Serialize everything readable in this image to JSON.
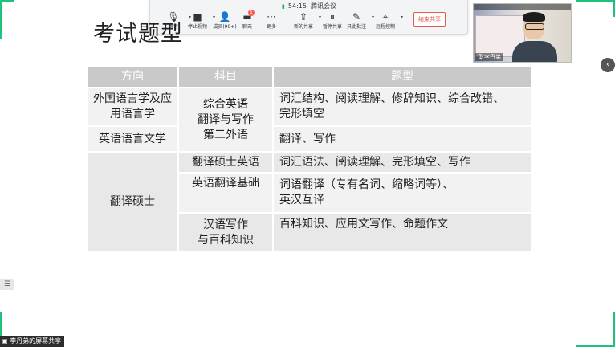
{
  "toolbar": {
    "time": "54:15",
    "app_name": "腾讯会议",
    "buttons": [
      {
        "label": "静音",
        "icon": "microphone-icon"
      },
      {
        "label": "停止视频",
        "icon": "camera-icon"
      },
      {
        "label": "成员(99+)",
        "icon": "members-icon"
      },
      {
        "label": "聊天",
        "icon": "chat-icon",
        "badge": "1"
      },
      {
        "label": "更多",
        "icon": "more-icon"
      },
      {
        "label": "新的共享",
        "icon": "share-icon"
      },
      {
        "label": "暂停共享",
        "icon": "pause-share-icon"
      },
      {
        "label": "只此批注",
        "icon": "annotate-icon"
      },
      {
        "label": "远程控制",
        "icon": "remote-control-icon"
      }
    ],
    "end_share": "结束共享"
  },
  "slide": {
    "title": "考试题型",
    "headers": [
      "方向",
      "科目",
      "题型"
    ],
    "rows": {
      "dir1": "外国语言学及应用语言学",
      "dir2": "英语语言文学",
      "dir3": "翻译硕士",
      "subj1": "综合英语\n翻译与写作\n第二外语",
      "subj2": "翻译硕士英语",
      "subj3": "英语翻译基础",
      "subj4": "汉语写作\n与百科知识",
      "type1": "词汇结构、阅读理解、修辞知识、综合改错、\n完形填空",
      "type2": "翻译、写作",
      "type3": "词汇语法、阅读理解、完形填空、写作",
      "type4": "词语翻译（专有名词、缩略词等）、\n英汉互译",
      "type5": "百科知识、应用文写作、命题作文"
    }
  },
  "video": {
    "name": "李丹弟"
  },
  "screen_share_label": "李丹弟的屏幕共享",
  "accent": "#1ec27a"
}
